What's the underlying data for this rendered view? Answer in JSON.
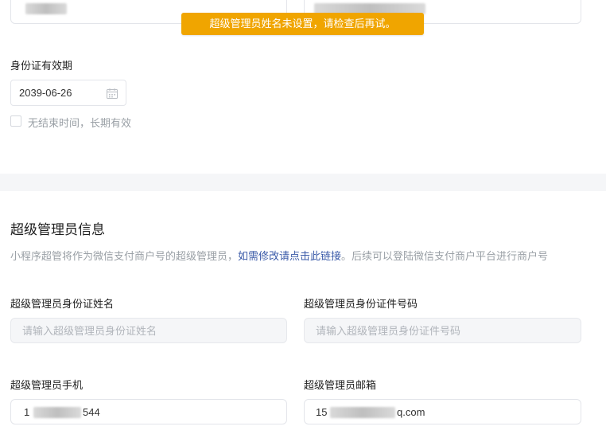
{
  "toast": {
    "message": "超级管理员姓名未设置，请检查后再试。"
  },
  "id_validity": {
    "label": "身份证有效期",
    "date_value": "2039-06-26",
    "no_end_label": "无结束时间，长期有效"
  },
  "admin_section": {
    "title": "超级管理员信息",
    "desc_before": "小程序超管将作为微信支付商户号的超级管理员，",
    "desc_link": "如需修改请点击此链接",
    "desc_after": "。后续可以登陆微信支付商户平台进行商户号"
  },
  "fields": {
    "name_label": "超级管理员身份证姓名",
    "name_placeholder": "请输入超级管理员身份证姓名",
    "id_number_label": "超级管理员身份证件号码",
    "id_number_placeholder": "请输入超级管理员身份证件号码",
    "phone_label": "超级管理员手机",
    "phone_value_start": "1",
    "phone_value_end": "544",
    "email_label": "超级管理员邮箱",
    "email_value_start": "15",
    "email_value_end": "q.com"
  },
  "icons": {
    "calendar": "calendar-icon"
  },
  "colors": {
    "toast_bg": "#f0a500",
    "link": "#3a5aa8",
    "muted_text": "#9aa0a6"
  }
}
